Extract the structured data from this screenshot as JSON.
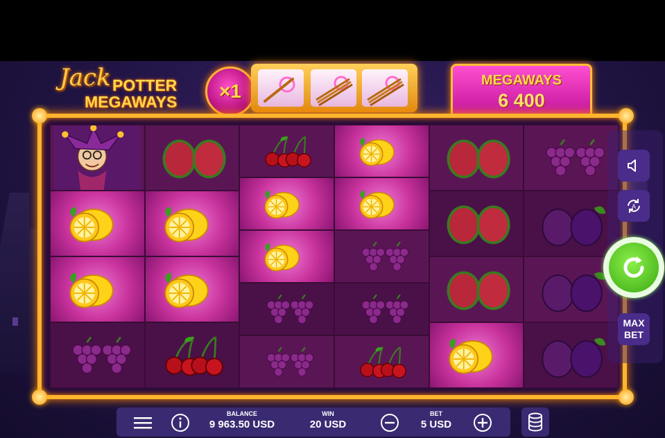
{
  "logo": {
    "line1": "Jack",
    "line2": "POTTER",
    "line3": "MEGAWAYS"
  },
  "multiplier": {
    "label": "×1"
  },
  "megaways": {
    "title": "MEGAWAYS",
    "value": "6 400"
  },
  "wands": [
    {
      "icon": "wand-single-icon"
    },
    {
      "icon": "wand-triple-icon"
    },
    {
      "icon": "wand-triple-icon"
    }
  ],
  "reels": [
    [
      {
        "symbol": "jester",
        "lit": false
      },
      {
        "symbol": "lemon",
        "lit": true
      },
      {
        "symbol": "lemon",
        "lit": true
      },
      {
        "symbol": "grapes",
        "lit": false
      }
    ],
    [
      {
        "symbol": "watermelon",
        "lit": false
      },
      {
        "symbol": "lemon",
        "lit": true
      },
      {
        "symbol": "lemon",
        "lit": true
      },
      {
        "symbol": "cherries",
        "lit": false
      }
    ],
    [
      {
        "symbol": "cherries",
        "lit": false
      },
      {
        "symbol": "lemon",
        "lit": true
      },
      {
        "symbol": "lemon",
        "lit": true
      },
      {
        "symbol": "grapes",
        "lit": false
      },
      {
        "symbol": "grapes",
        "lit": false
      }
    ],
    [
      {
        "symbol": "lemon",
        "lit": true
      },
      {
        "symbol": "lemon",
        "lit": true
      },
      {
        "symbol": "grapes",
        "lit": false
      },
      {
        "symbol": "grapes",
        "lit": false
      },
      {
        "symbol": "cherries",
        "lit": false
      }
    ],
    [
      {
        "symbol": "watermelon",
        "lit": false
      },
      {
        "symbol": "watermelon",
        "lit": false
      },
      {
        "symbol": "watermelon",
        "lit": false
      },
      {
        "symbol": "lemon",
        "lit": true
      }
    ],
    [
      {
        "symbol": "grapes",
        "lit": false
      },
      {
        "symbol": "plums",
        "lit": false
      },
      {
        "symbol": "plums",
        "lit": false
      },
      {
        "symbol": "plums",
        "lit": false
      }
    ]
  ],
  "side": {
    "sound_icon": "speaker-icon",
    "autoplay_icon": "autoplay-icon",
    "spin_icon": "spin-arrow-icon",
    "max_bet": "MAX BET"
  },
  "bottom": {
    "balance_label": "BALANCE",
    "balance_value": "9 963.50 USD",
    "win_label": "WIN",
    "win_value": "20 USD",
    "bet_label": "BET",
    "bet_value": "5 USD"
  },
  "colors": {
    "gold": "#ffb52e",
    "pink": "#c8329c",
    "spin_green": "#3aa812"
  }
}
